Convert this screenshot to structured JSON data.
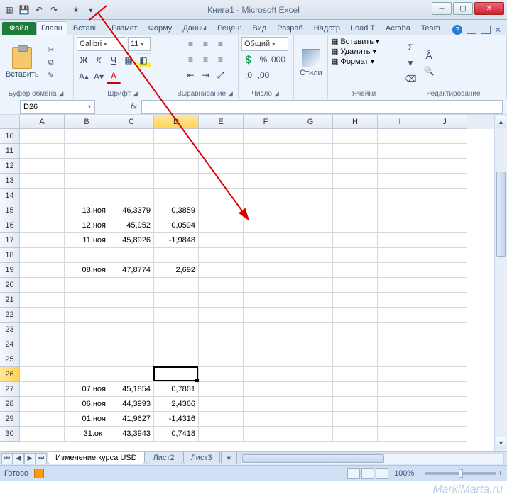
{
  "title": "Книга1 - Microsoft Excel",
  "tabs": {
    "file": "Файл",
    "items": [
      "Главн",
      "Встав⊢",
      "Размет",
      "Форму",
      "Данны",
      "Рецен:",
      "Вид",
      "Разраб",
      "Надстр",
      "Load T",
      "Acroba",
      "Team"
    ],
    "activeIndex": 0
  },
  "ribbon": {
    "clipboard": {
      "paste": "Вставить",
      "label": "Буфер обмена"
    },
    "font": {
      "name": "Calibri",
      "size": "11",
      "bold": "Ж",
      "italic": "К",
      "underline": "Ч",
      "label": "Шрифт"
    },
    "align": {
      "label": "Выравнивание"
    },
    "number": {
      "format": "Общий",
      "label": "Число"
    },
    "styles": {
      "btn": "Стили"
    },
    "cells": {
      "insert": "Вставить",
      "delete": "Удалить",
      "format": "Формат",
      "label": "Ячейки"
    },
    "editing": {
      "label": "Редактирование"
    }
  },
  "nameBox": "D26",
  "fx": "fx",
  "columns": [
    "A",
    "B",
    "C",
    "D",
    "E",
    "F",
    "G",
    "H",
    "I",
    "J"
  ],
  "rowStart": 10,
  "rowEnd": 30,
  "selectedRow": 26,
  "selectedCol": 3,
  "data": {
    "15": {
      "B": "13.ноя",
      "C": "46,3379",
      "D": "0,3859"
    },
    "16": {
      "B": "12.ноя",
      "C": "45,952",
      "D": "0,0594"
    },
    "17": {
      "B": "11.ноя",
      "C": "45,8926",
      "D": "-1,9848"
    },
    "19": {
      "B": "08.ноя",
      "C": "47,8774",
      "D": "2,692"
    },
    "27": {
      "B": "07.ноя",
      "C": "45,1854",
      "D": "0,7861"
    },
    "28": {
      "B": "06.ноя",
      "C": "44,3993",
      "D": "2,4366"
    },
    "29": {
      "B": "01.ноя",
      "C": "41,9627",
      "D": "-1,4316"
    },
    "30": {
      "B": "31.окт",
      "C": "43,3943",
      "D": "0,7418"
    }
  },
  "sheets": {
    "active": "Изменение курса USD",
    "others": [
      "Лист2",
      "Лист3"
    ]
  },
  "status": {
    "ready": "Готово",
    "zoom": "100%"
  },
  "watermark": "MarkiMarta.ru"
}
